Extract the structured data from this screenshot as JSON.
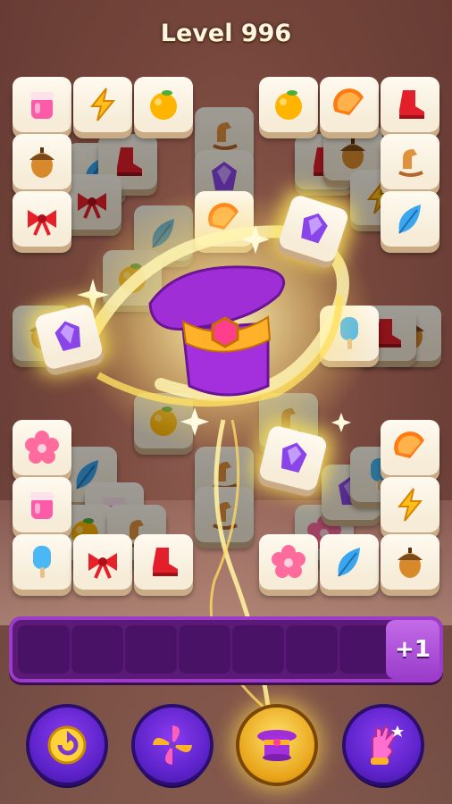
{
  "level": {
    "label": "Level 996"
  },
  "tray": {
    "bonus_label": "+1",
    "slots": 7
  },
  "tiles": [
    {
      "icon": "jam-jar-icon"
    },
    {
      "icon": "lightning-icon"
    },
    {
      "icon": "lemon-icon"
    },
    {
      "icon": "lemon-icon"
    },
    {
      "icon": "orange-slice-icon"
    },
    {
      "icon": "red-boot-icon"
    },
    {
      "icon": "acorn-icon"
    },
    {
      "icon": "rocking-horse-icon"
    },
    {
      "icon": "red-bow-icon"
    },
    {
      "icon": "blue-feather-icon"
    },
    {
      "icon": "flower-icon"
    },
    {
      "icon": "orange-slice-icon"
    },
    {
      "icon": "jam-jar-icon"
    },
    {
      "icon": "lightning-icon"
    },
    {
      "icon": "popsicle-icon"
    },
    {
      "icon": "red-bow-icon"
    },
    {
      "icon": "red-boot-icon"
    },
    {
      "icon": "flower-icon"
    },
    {
      "icon": "blue-feather-icon"
    },
    {
      "icon": "acorn-icon"
    },
    {
      "icon": "purple-gem-icon"
    },
    {
      "icon": "purple-gem-icon"
    },
    {
      "icon": "purple-gem-icon"
    },
    {
      "icon": "popsicle-icon"
    },
    {
      "icon": "orange-slice-icon"
    }
  ],
  "boosters": [
    {
      "icon": "undo-arrow-icon",
      "active": false
    },
    {
      "icon": "pinwheel-icon",
      "active": false
    },
    {
      "icon": "magic-hat-icon",
      "active": true
    },
    {
      "icon": "magic-glove-icon",
      "active": false
    }
  ],
  "colors": {
    "tray": "#5b1a78",
    "booster": "#5b22c8",
    "booster_active": "#e8a318",
    "title": "#fff6e0"
  }
}
